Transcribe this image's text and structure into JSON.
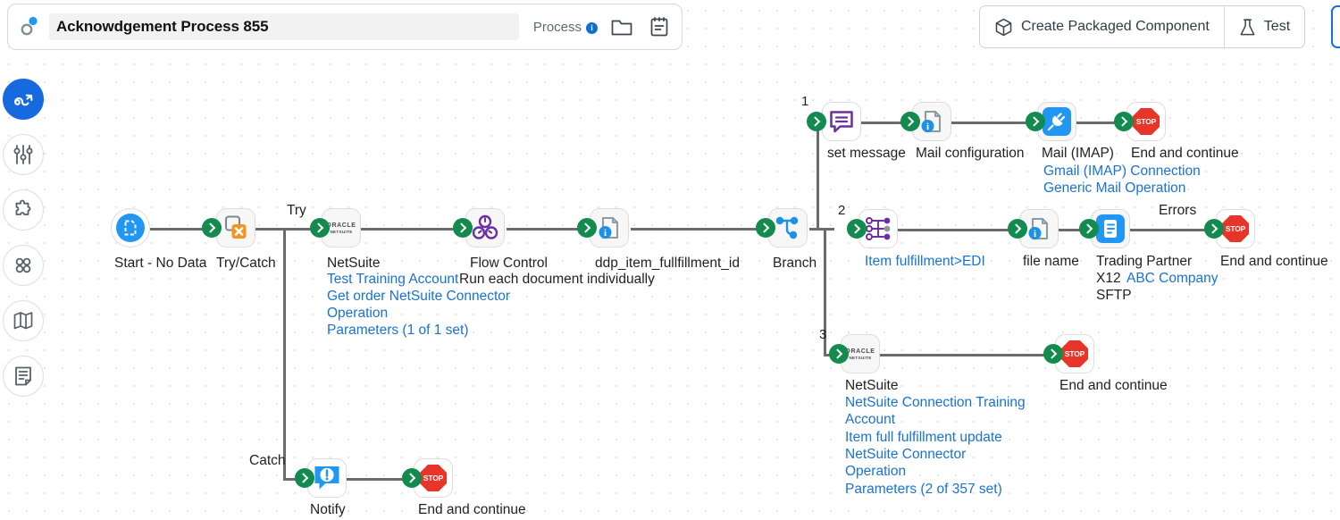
{
  "header": {
    "logo_icon": "process-logo-icon",
    "title": "Acknowdgement Process 855",
    "type_label": "Process",
    "info_icon": "info-icon",
    "folder_icon": "folder-icon",
    "notes_icon": "notes-icon"
  },
  "toolbar": {
    "create_packaged_component": "Create Packaged Component",
    "create_packaged_component_icon": "package-box-icon",
    "test": "Test",
    "test_icon": "flask-icon"
  },
  "sidebar": {
    "items": [
      {
        "name": "process-flow",
        "icon": "flow-arrow-icon",
        "active": true
      },
      {
        "name": "settings",
        "icon": "sliders-icon",
        "active": false
      },
      {
        "name": "extensions",
        "icon": "puzzle-piece-icon",
        "active": false
      },
      {
        "name": "components",
        "icon": "four-circles-icon",
        "active": false
      },
      {
        "name": "map",
        "icon": "map-icon",
        "active": false
      },
      {
        "name": "documentation",
        "icon": "document-icon",
        "active": false
      }
    ]
  },
  "flow": {
    "start": {
      "label": "Start - No Data",
      "icon": "start-document-icon"
    },
    "try_catch": {
      "label": "Try/Catch",
      "icon": "try-catch-icon"
    },
    "try_label": "Try",
    "catch_label": "Catch",
    "netsuite_main": {
      "label": "NetSuite",
      "icon": "oracle-netsuite-logo",
      "links": [
        "Test Training Account",
        "Get order NetSuite Connector",
        "Operation",
        "Parameters (1 of 1 set)"
      ]
    },
    "flow_control": {
      "label": "Flow Control",
      "icon": "flow-control-icon",
      "sublabel": "Run each document individually"
    },
    "ddp": {
      "label": "ddp_item_fullfillment_id",
      "icon": "document-info-icon"
    },
    "branch": {
      "label": "Branch",
      "icon": "branch-icon"
    },
    "branch_numbers": {
      "one": "1",
      "two": "2",
      "three": "3"
    },
    "branch1": {
      "set_message": {
        "label": "set message",
        "icon": "message-icon"
      },
      "mail_config": {
        "label": "Mail configuration",
        "icon": "document-info-icon"
      },
      "mail_imap": {
        "label": "Mail (IMAP)",
        "icon": "plug-connector-icon",
        "links": [
          "Gmail (IMAP) Connection",
          "Generic Mail Operation"
        ]
      },
      "end": {
        "label": "End and continue",
        "icon": "stop-icon"
      }
    },
    "branch2": {
      "map": {
        "label": "Item fulfillment>EDI",
        "icon": "map-transform-icon"
      },
      "file_name": {
        "label": "file name",
        "icon": "document-info-icon"
      },
      "trading_partner": {
        "label": "Trading Partner",
        "icon": "trading-partner-icon",
        "standard": "X12",
        "company": "ABC Company",
        "transport": "SFTP"
      },
      "errors_label": "Errors",
      "end": {
        "label": "End and continue",
        "icon": "stop-icon"
      }
    },
    "branch3": {
      "netsuite": {
        "label": "NetSuite",
        "icon": "oracle-netsuite-logo",
        "links": [
          "NetSuite Connection Training",
          "Account",
          "Item full fulfillment update",
          "NetSuite Connector",
          "Operation",
          "Parameters (2 of 357 set)"
        ]
      },
      "end": {
        "label": "End and continue",
        "icon": "stop-icon"
      }
    },
    "catch_branch": {
      "notify": {
        "label": "Notify",
        "icon": "notify-icon"
      },
      "end": {
        "label": "End and continue",
        "icon": "stop-icon"
      }
    }
  },
  "colors": {
    "accent_blue": "#1769e0",
    "link_blue": "#1a73d1",
    "connector_green": "#138a4e",
    "stop_red": "#e8352a",
    "purple": "#6a2fa0",
    "orange": "#f5951f"
  }
}
